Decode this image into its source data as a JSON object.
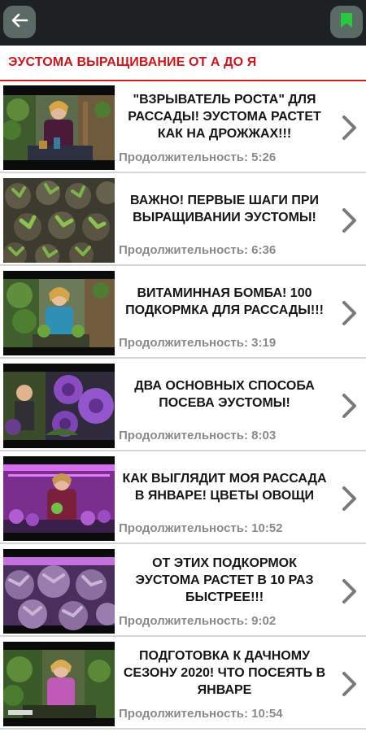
{
  "header": {
    "back_icon": "arrow-left-icon",
    "bookmark_icon": "bookmark-icon",
    "button_bg": "#5c6a66",
    "bookmark_color": "#27c93f"
  },
  "section": {
    "title": "ЭУСТОМА ВЫРАЩИВАНИЕ ОТ А ДО Я",
    "accent": "#d0141a"
  },
  "duration_label": "Продолжительность:",
  "videos": [
    {
      "title": "\"ВЗРЫВАТЕЛЬ РОСТА\" ДЛЯ РАССАДЫ! ЭУСТОМА РАСТЕТ КАК НА ДРОЖЖАХ!!!",
      "duration": "Продолжительность: 5:26"
    },
    {
      "title": "ВАЖНО! ПЕРВЫЕ ШАГИ ПРИ ВЫРАЩИВАНИИ ЭУСТОМЫ!",
      "duration": "Продолжительность: 6:36"
    },
    {
      "title": "ВИТАМИННАЯ БОМБА! 100 ПОДКОРМКА ДЛЯ РАССАДЫ!!!",
      "duration": "Продолжительность: 3:19"
    },
    {
      "title": "ДВА ОСНОВНЫХ СПОСОБА ПОСЕВА ЭУСТОМЫ!",
      "duration": "Продолжительность: 8:03"
    },
    {
      "title": "КАК ВЫГЛЯДИТ МОЯ РАССАДА В ЯНВАРЕ! ЦВЕТЫ ОВОЩИ",
      "duration": "Продолжительность: 10:52"
    },
    {
      "title": "ОТ ЭТИХ ПОДКОРМОК ЭУСТОМА РАСТЕТ В 10 РАЗ БЫСТРЕЕ!!!",
      "duration": "Продолжительность: 9:02"
    },
    {
      "title": "ПОДГОТОВКА К ДАЧНОМУ СЕЗОНУ 2020! ЧТО ПОСЕЯТЬ В ЯНВАРЕ",
      "duration": "Продолжительность: 10:54"
    }
  ]
}
